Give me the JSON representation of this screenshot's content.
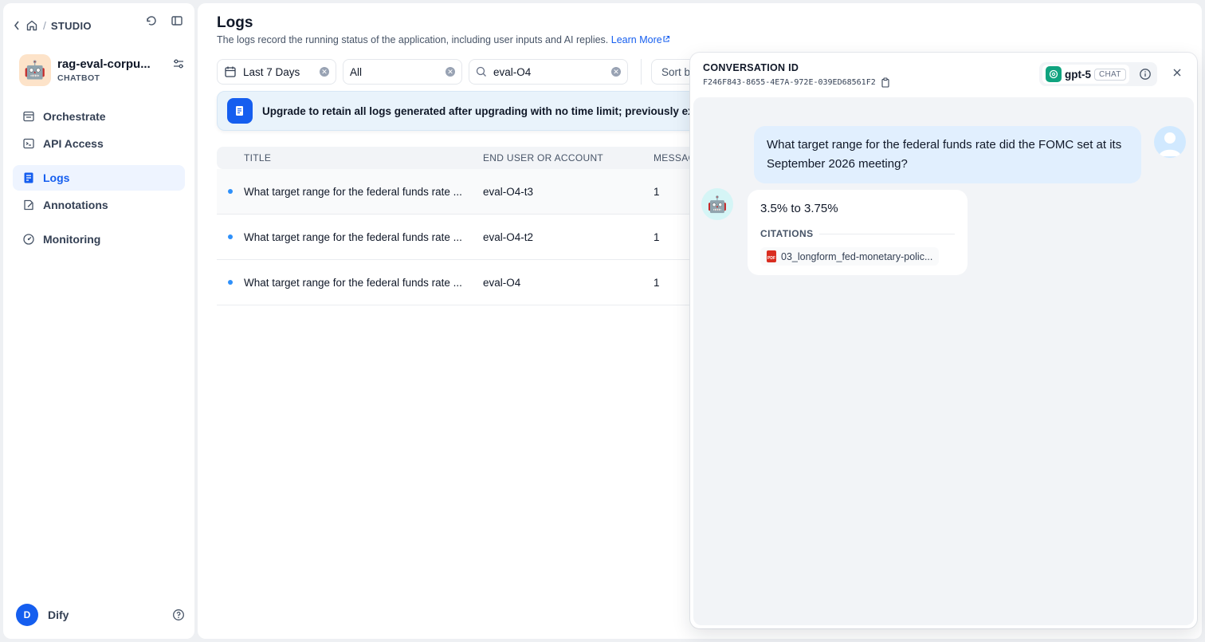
{
  "sidebar": {
    "breadcrumb": {
      "slash": "/",
      "section": "STUDIO"
    },
    "app": {
      "name": "rag-eval-corpu...",
      "type": "CHATBOT",
      "avatar_emoji": "🤖"
    },
    "nav": [
      {
        "label": "Orchestrate",
        "icon": "orchestrate-icon"
      },
      {
        "label": "API Access",
        "icon": "terminal-icon"
      },
      {
        "label": "Logs",
        "icon": "logs-icon",
        "active": true
      },
      {
        "label": "Annotations",
        "icon": "annotations-icon"
      },
      {
        "label": "Monitoring",
        "icon": "monitoring-icon"
      }
    ],
    "user": {
      "initial": "D",
      "name": "Dify"
    }
  },
  "main": {
    "title": "Logs",
    "description": "The logs record the running status of the application, including user inputs and AI replies.",
    "learn_more": "Learn More",
    "filters": {
      "period": "Last 7 Days",
      "status": "All",
      "search_value": "eval-O4",
      "sort_label": "Sort by:"
    },
    "banner": "Upgrade to retain all logs generated after upgrading with no time limit; previously expir",
    "table": {
      "headers": [
        "TITLE",
        "END USER OR ACCOUNT",
        "MESSAG"
      ],
      "rows": [
        {
          "title": "What target range for the federal funds rate ...",
          "user": "eval-O4-t3",
          "messages": "1"
        },
        {
          "title": "What target range for the federal funds rate ...",
          "user": "eval-O4-t2",
          "messages": "1"
        },
        {
          "title": "What target range for the federal funds rate ...",
          "user": "eval-O4",
          "messages": "1"
        }
      ]
    }
  },
  "drawer": {
    "label": "CONVERSATION ID",
    "conversation_id": "F246F843-8655-4E7A-972E-039ED68561F2",
    "model": {
      "name": "gpt-5",
      "mode": "CHAT"
    },
    "question": "What target range for the federal funds rate did the FOMC set at its September 2026 meeting?",
    "answer": "3.5% to 3.75%",
    "citations_label": "CITATIONS",
    "citations": [
      "03_longform_fed-monetary-polic..."
    ],
    "pdf_badge": "PDF",
    "bot_emoji": "🤖"
  },
  "colors": {
    "accent": "#155eef",
    "model_brand": "#10a37f",
    "pdf": "#d92d20"
  }
}
